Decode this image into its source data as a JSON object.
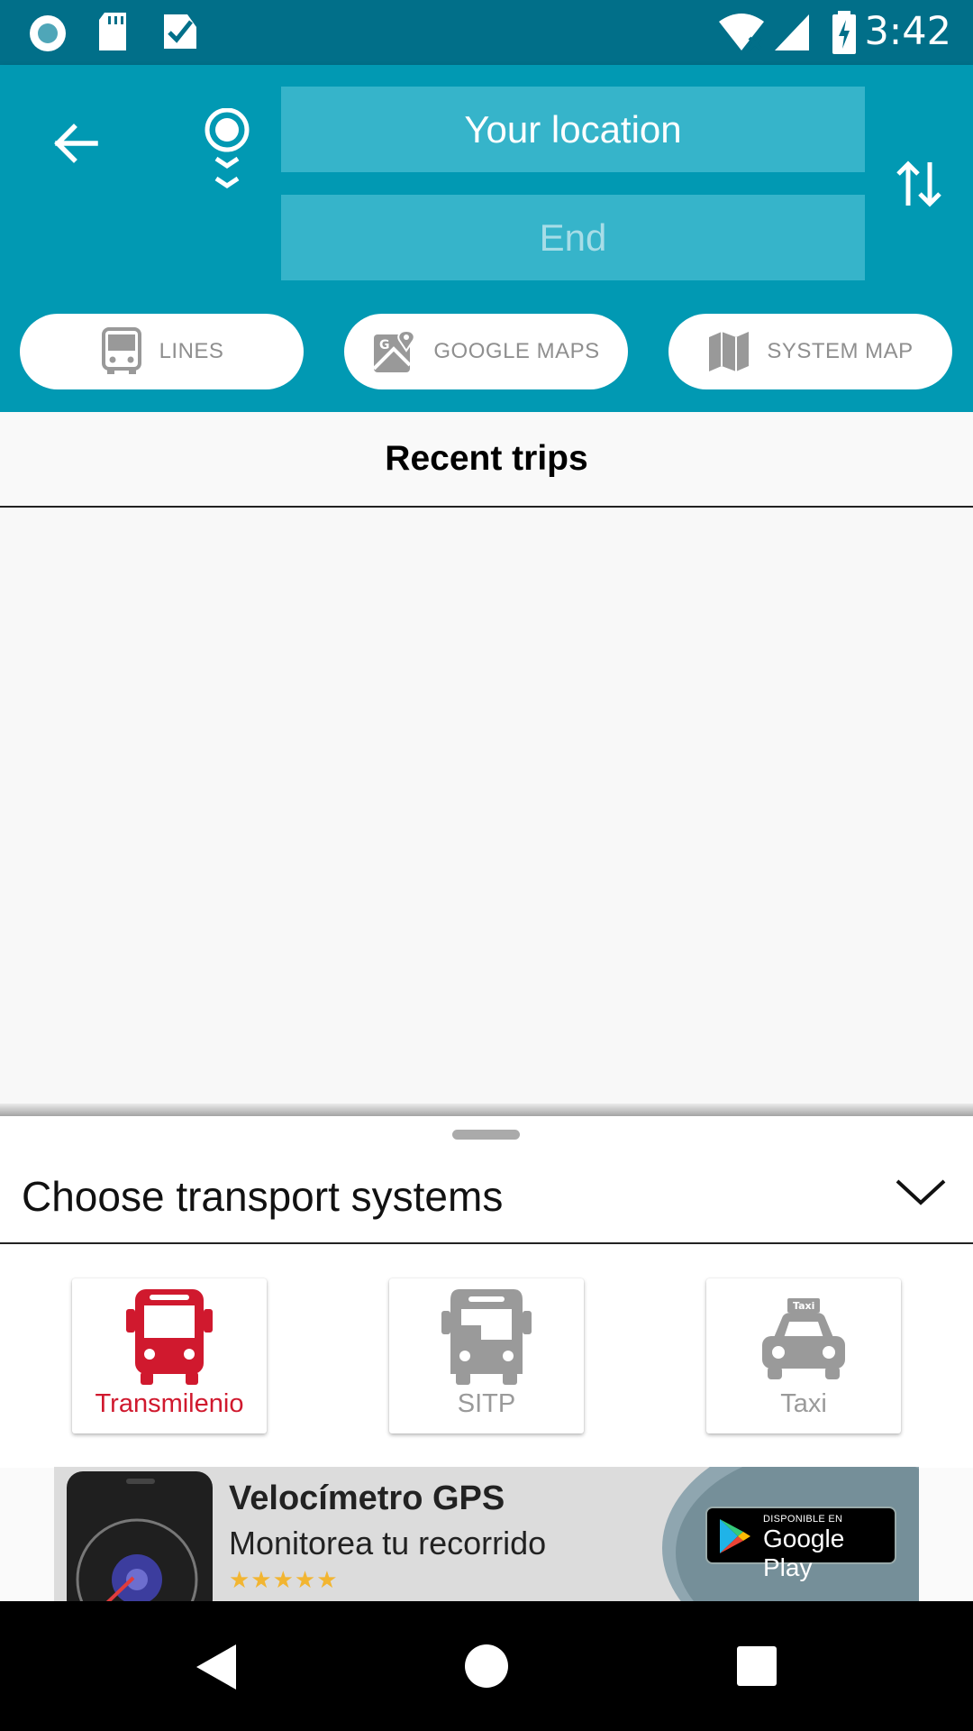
{
  "status_bar": {
    "time": "3:42",
    "left_icons": [
      "circle-app-icon",
      "sd-card-icon",
      "task-check-icon"
    ],
    "right_icons": [
      "wifi-icon",
      "signal-icon",
      "battery-charging-icon"
    ]
  },
  "header": {
    "back_icon": "arrow-left-icon",
    "start_placeholder": "Your location",
    "end_placeholder": "End",
    "swap_icon": "swap-vertical-icon",
    "colors": {
      "primary": "#0199b3",
      "status": "#016f89",
      "field": "#36b4ca"
    }
  },
  "quick_actions": [
    {
      "label": "LINES",
      "icon": "bus-front-icon"
    },
    {
      "label": "GOOGLE MAPS",
      "icon": "google-maps-icon"
    },
    {
      "label": "SYSTEM MAP",
      "icon": "folded-map-icon"
    }
  ],
  "recent": {
    "title": "Recent trips"
  },
  "transport_sheet": {
    "title": "Choose transport systems",
    "toggle_icon": "chevron-down-icon",
    "systems": [
      {
        "label": "Transmilenio",
        "icon": "bus-icon",
        "selected": true,
        "color": "#d0192e"
      },
      {
        "label": "SITP",
        "icon": "bus-icon",
        "selected": false,
        "color": "#9a9a9a"
      },
      {
        "label": "Taxi",
        "icon": "taxi-icon",
        "selected": false,
        "color": "#9a9a9a"
      }
    ]
  },
  "ad": {
    "title": "Velocímetro GPS",
    "subtitle": "Monitorea tu recorrido",
    "stars": "★★★★★",
    "badge_small": "DISPONIBLE EN",
    "badge_big": "Google Play"
  },
  "nav_bar": {
    "icons": [
      "back-triangle-icon",
      "home-circle-icon",
      "recents-square-icon"
    ]
  }
}
